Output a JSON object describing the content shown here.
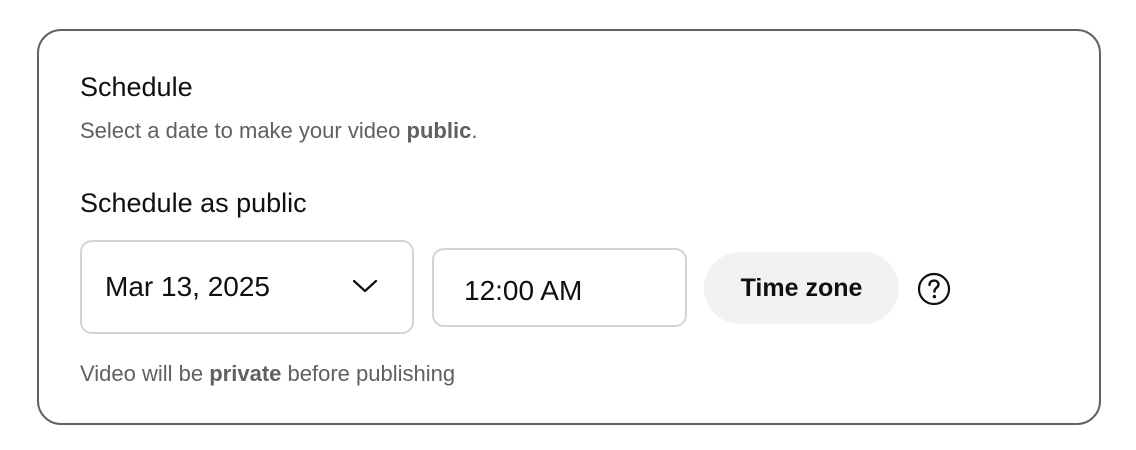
{
  "schedule": {
    "title": "Schedule",
    "subtitle_prefix": "Select a date to make your video ",
    "subtitle_bold": "public",
    "subtitle_suffix": ".",
    "section_label": "Schedule as public",
    "date": {
      "value": "Mar 13, 2025",
      "icon": "chevron-down-icon"
    },
    "time": {
      "value": "12:00 AM"
    },
    "timezone_button_label": "Time zone",
    "help_icon": "help-circle-icon",
    "note_prefix": "Video will be ",
    "note_bold": "private",
    "note_suffix": " before publishing"
  },
  "colors": {
    "text_primary": "#0f0f0f",
    "text_secondary": "#606060",
    "card_border": "#5f6368",
    "field_border": "#d3d3d3",
    "button_bg": "#f2f2f2"
  }
}
